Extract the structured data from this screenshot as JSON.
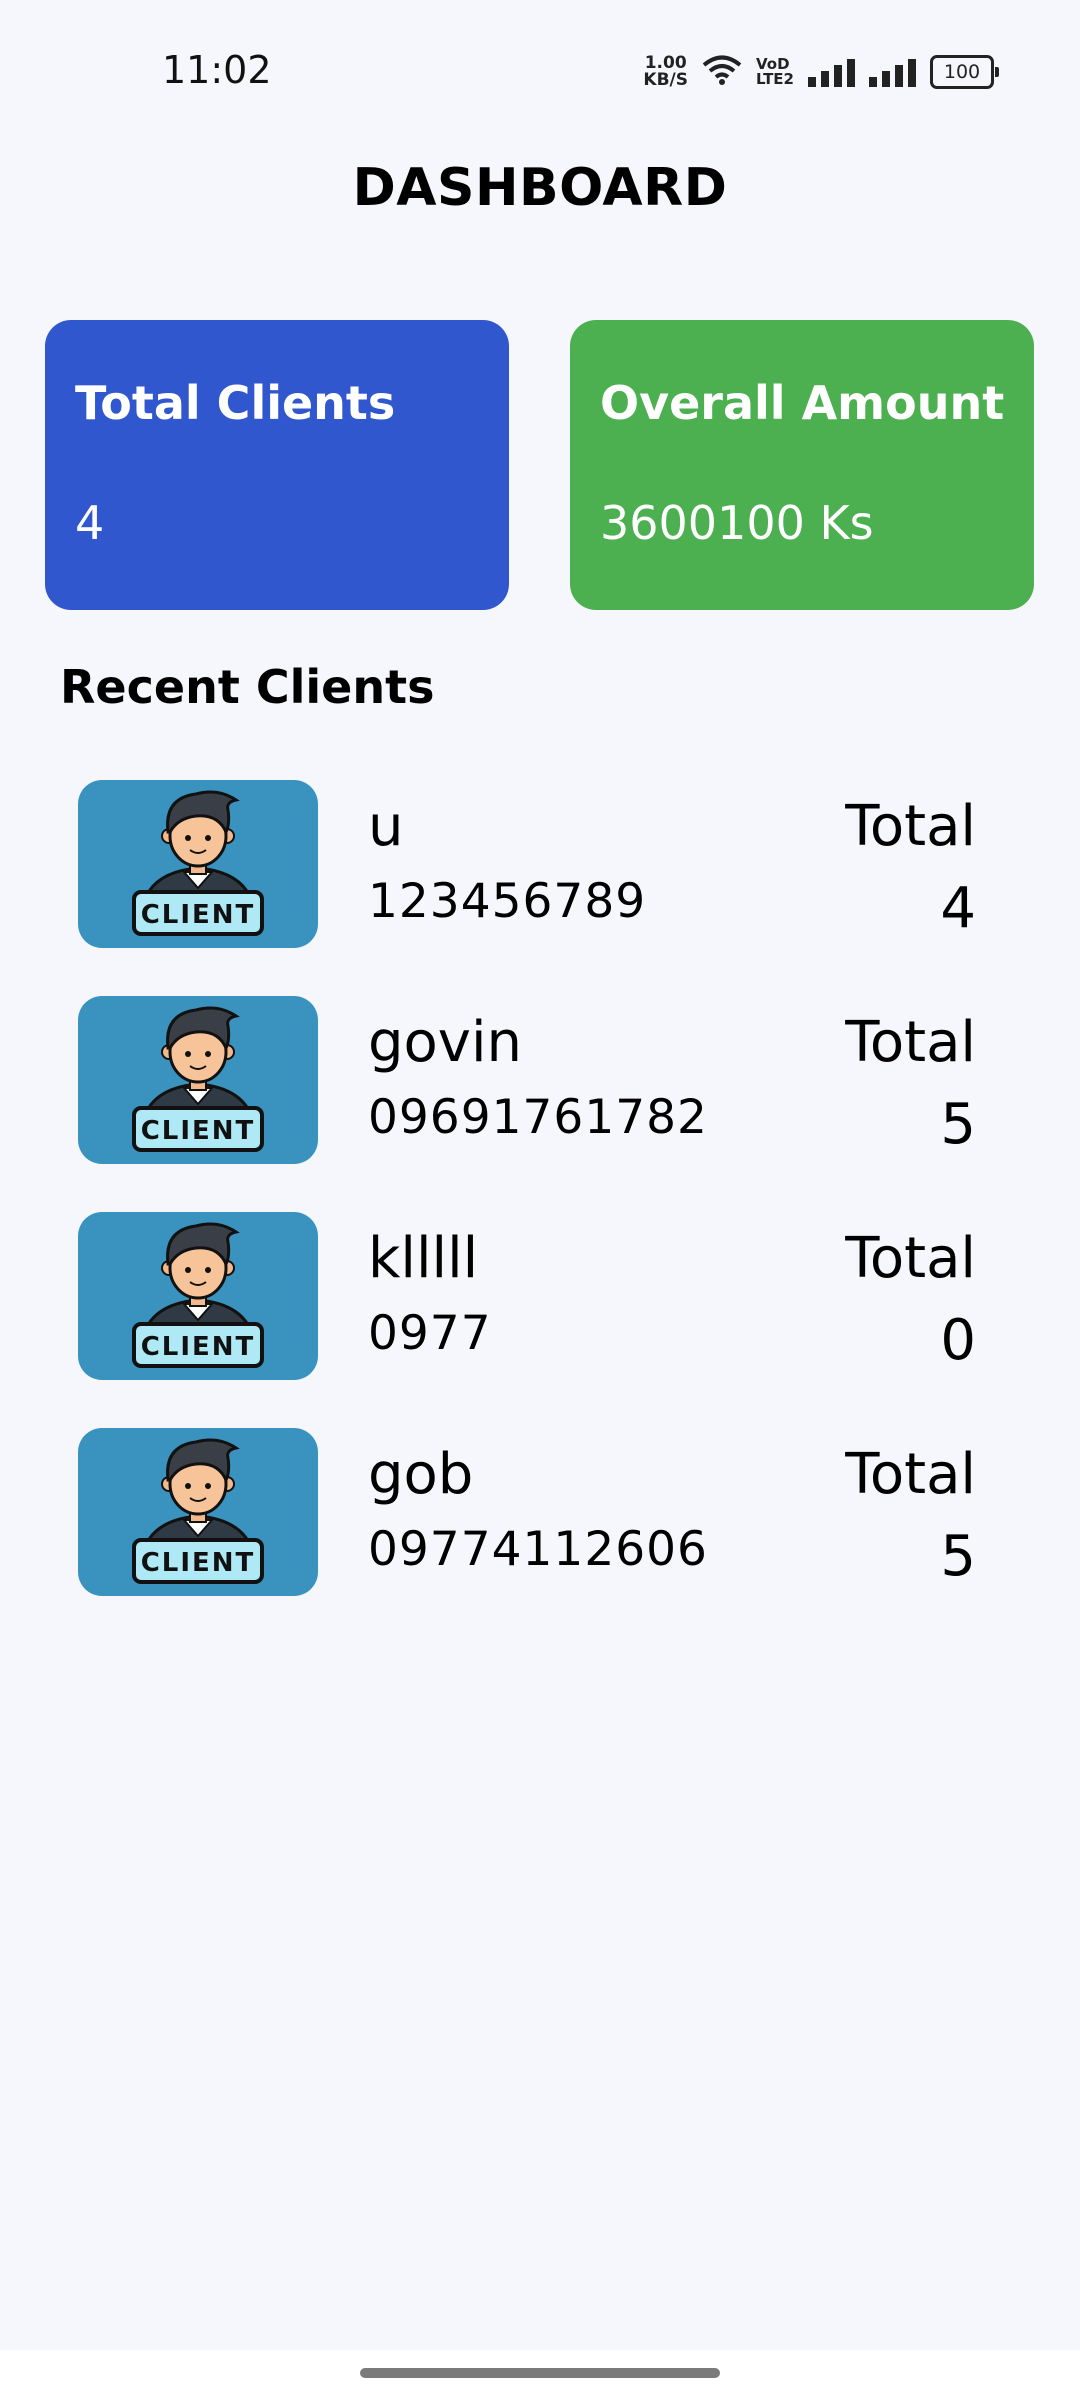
{
  "status": {
    "time": "11:02",
    "net_speed_value": "1.00",
    "net_speed_unit": "KB/S",
    "volte_top": "VoD",
    "volte_bottom": "LTE2",
    "battery": "100"
  },
  "header": {
    "title": "DASHBOARD"
  },
  "stats": {
    "clients": {
      "label": "Total Clients",
      "value": "4",
      "color": "#3057ce"
    },
    "amount": {
      "label": "Overall Amount",
      "value": "3600100 Ks",
      "color": "#4caf50"
    }
  },
  "recent": {
    "title": "Recent Clients",
    "avatar_badge": "CLIENT",
    "items": [
      {
        "name": "u",
        "phone": "123456789",
        "total_label": "Total",
        "total": "4"
      },
      {
        "name": "govin",
        "phone": "09691761782",
        "total_label": "Total",
        "total": "5"
      },
      {
        "name": "klllll",
        "phone": "0977",
        "total_label": "Total",
        "total": "0"
      },
      {
        "name": "gob",
        "phone": "09774112606",
        "total_label": "Total",
        "total": "5"
      }
    ]
  },
  "icons": {
    "avatar": "client-avatar-icon",
    "wifi": "wifi-icon",
    "signal": "signal-icon",
    "battery": "battery-icon"
  }
}
